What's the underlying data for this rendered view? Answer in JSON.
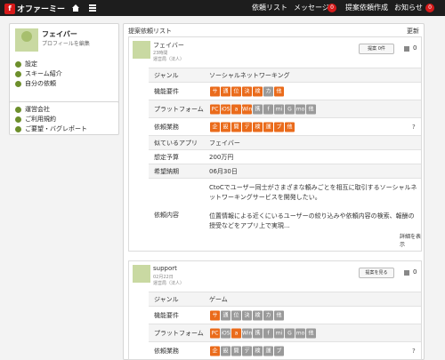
{
  "header": {
    "logo_mark": "f",
    "logo_text": "オファーミー",
    "nav": [
      {
        "label": "依頼リスト"
      },
      {
        "label": "メッセージ",
        "badge": "0"
      },
      {
        "label": "提案依頼作成"
      },
      {
        "label": "お知らせ",
        "badge": "0"
      }
    ]
  },
  "profile": {
    "name": "フェイバー",
    "edit": "プロフィールを編集",
    "links": [
      "設定",
      "スキーム紹介",
      "自分の依頼"
    ]
  },
  "support_links": [
    "運営会社",
    "ご利用規約",
    "ご要望・バグレポート"
  ],
  "main": {
    "title": "提案依頼リスト",
    "update": "更新"
  },
  "cards": [
    {
      "user": "フェイバー",
      "date": "23時間",
      "company": "運営局（法人）",
      "btn": "提案 0件",
      "comment_count": "0",
      "rows": [
        {
          "label": "ジャンル",
          "value": "ソーシャルネットワーキング"
        },
        {
          "label": "機能要件",
          "tags": [
            {
              "t": "サ",
              "on": true
            },
            {
              "t": "通",
              "on": true
            },
            {
              "t": "位",
              "on": true
            },
            {
              "t": "決",
              "on": true
            },
            {
              "t": "検",
              "on": true
            },
            {
              "t": "カ",
              "on": false
            },
            {
              "t": "他",
              "on": true
            }
          ]
        },
        {
          "label": "プラットフォーム",
          "tags": [
            {
              "t": "PC",
              "on": true
            },
            {
              "t": "iOS",
              "on": true
            },
            {
              "t": "a",
              "on": true
            },
            {
              "t": "Win",
              "on": true
            },
            {
              "t": "携",
              "on": false
            },
            {
              "t": "f",
              "on": false
            },
            {
              "t": "mi",
              "on": false
            },
            {
              "t": "G",
              "on": false
            },
            {
              "t": "mo",
              "on": false
            },
            {
              "t": "他",
              "on": false
            }
          ]
        },
        {
          "label": "依頼業務",
          "tags": [
            {
              "t": "企",
              "on": true
            },
            {
              "t": "設",
              "on": true
            },
            {
              "t": "開",
              "on": true
            },
            {
              "t": "デ",
              "on": true
            },
            {
              "t": "検",
              "on": true
            },
            {
              "t": "運",
              "on": true
            },
            {
              "t": "ブ",
              "on": true
            },
            {
              "t": "他",
              "on": true
            }
          ],
          "help": "?"
        },
        {
          "label": "似ているアプリ",
          "value": "フェイバー"
        },
        {
          "label": "想定予算",
          "value": "200万円"
        },
        {
          "label": "希望納期",
          "value": "06月30日"
        },
        {
          "label": "依頼内容",
          "desc": [
            "CtoCでユーザー同士がさまざまな頼みごとを相互に取引するソーシャルネットワーキングサービスを開発したい。",
            "位置情報による近くにいるユーザーの絞り込みや依頼内容の検索、報酬の授受などをアプリ上で実現..."
          ],
          "more": "詳細を表示"
        }
      ]
    },
    {
      "user": "support",
      "date": "02月22日",
      "company": "運営局（法人）",
      "btn": "提案を見る",
      "comment_count": "0",
      "rows": [
        {
          "label": "ジャンル",
          "value": "ゲーム"
        },
        {
          "label": "機能要件",
          "tags": [
            {
              "t": "サ",
              "on": true
            },
            {
              "t": "通",
              "on": false
            },
            {
              "t": "位",
              "on": false
            },
            {
              "t": "決",
              "on": false
            },
            {
              "t": "検",
              "on": false
            },
            {
              "t": "カ",
              "on": false
            },
            {
              "t": "他",
              "on": false
            }
          ]
        },
        {
          "label": "プラットフォーム",
          "tags": [
            {
              "t": "PC",
              "on": true
            },
            {
              "t": "iOS",
              "on": false
            },
            {
              "t": "a",
              "on": true
            },
            {
              "t": "Win",
              "on": false
            },
            {
              "t": "携",
              "on": false
            },
            {
              "t": "f",
              "on": false
            },
            {
              "t": "mi",
              "on": false
            },
            {
              "t": "G",
              "on": false
            },
            {
              "t": "mo",
              "on": false
            },
            {
              "t": "他",
              "on": false
            }
          ]
        },
        {
          "label": "依頼業務",
          "tags": [
            {
              "t": "企",
              "on": true
            },
            {
              "t": "設",
              "on": false
            },
            {
              "t": "開",
              "on": false
            },
            {
              "t": "デ",
              "on": false
            },
            {
              "t": "検",
              "on": false
            },
            {
              "t": "運",
              "on": false
            },
            {
              "t": "ブ",
              "on": false
            }
          ],
          "help": "?"
        }
      ]
    }
  ]
}
